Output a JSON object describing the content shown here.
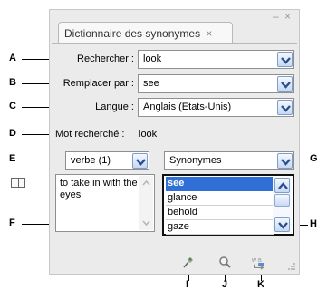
{
  "panel": {
    "tab_title": "Dictionnaire des synonymes",
    "tab_close": "×",
    "minimize_glyph": "–",
    "close_glyph": "×"
  },
  "form": {
    "search_label": "Rechercher :",
    "search_value": "look",
    "replace_label": "Remplacer par :",
    "replace_value": "see",
    "language_label": "Langue :",
    "language_value": "Anglais (Etats-Unis)",
    "looked_up_label": "Mot recherché :",
    "looked_up_value": "look"
  },
  "meanings": {
    "part_of_speech": "verbe (1)",
    "relation": "Synonymes",
    "definition": "to take in with the eyes"
  },
  "synonyms": [
    "see",
    "glance",
    "behold",
    "gaze"
  ],
  "selected_synonym_index": 0,
  "callouts": [
    "A",
    "B",
    "C",
    "D",
    "E",
    "F",
    "G",
    "H",
    "I",
    "J",
    "K"
  ],
  "icons": {
    "meaning_book": "dictionary-book-icon",
    "lookup": "lookup-pin-icon",
    "search": "magnifier-search-icon",
    "replace": "replace-word-icon",
    "resize": "resize-grip-icon"
  },
  "colors": {
    "selection": "#2f6fd6",
    "combo_button": "#c7d8f3",
    "panel_bg": "#ebebeb"
  }
}
